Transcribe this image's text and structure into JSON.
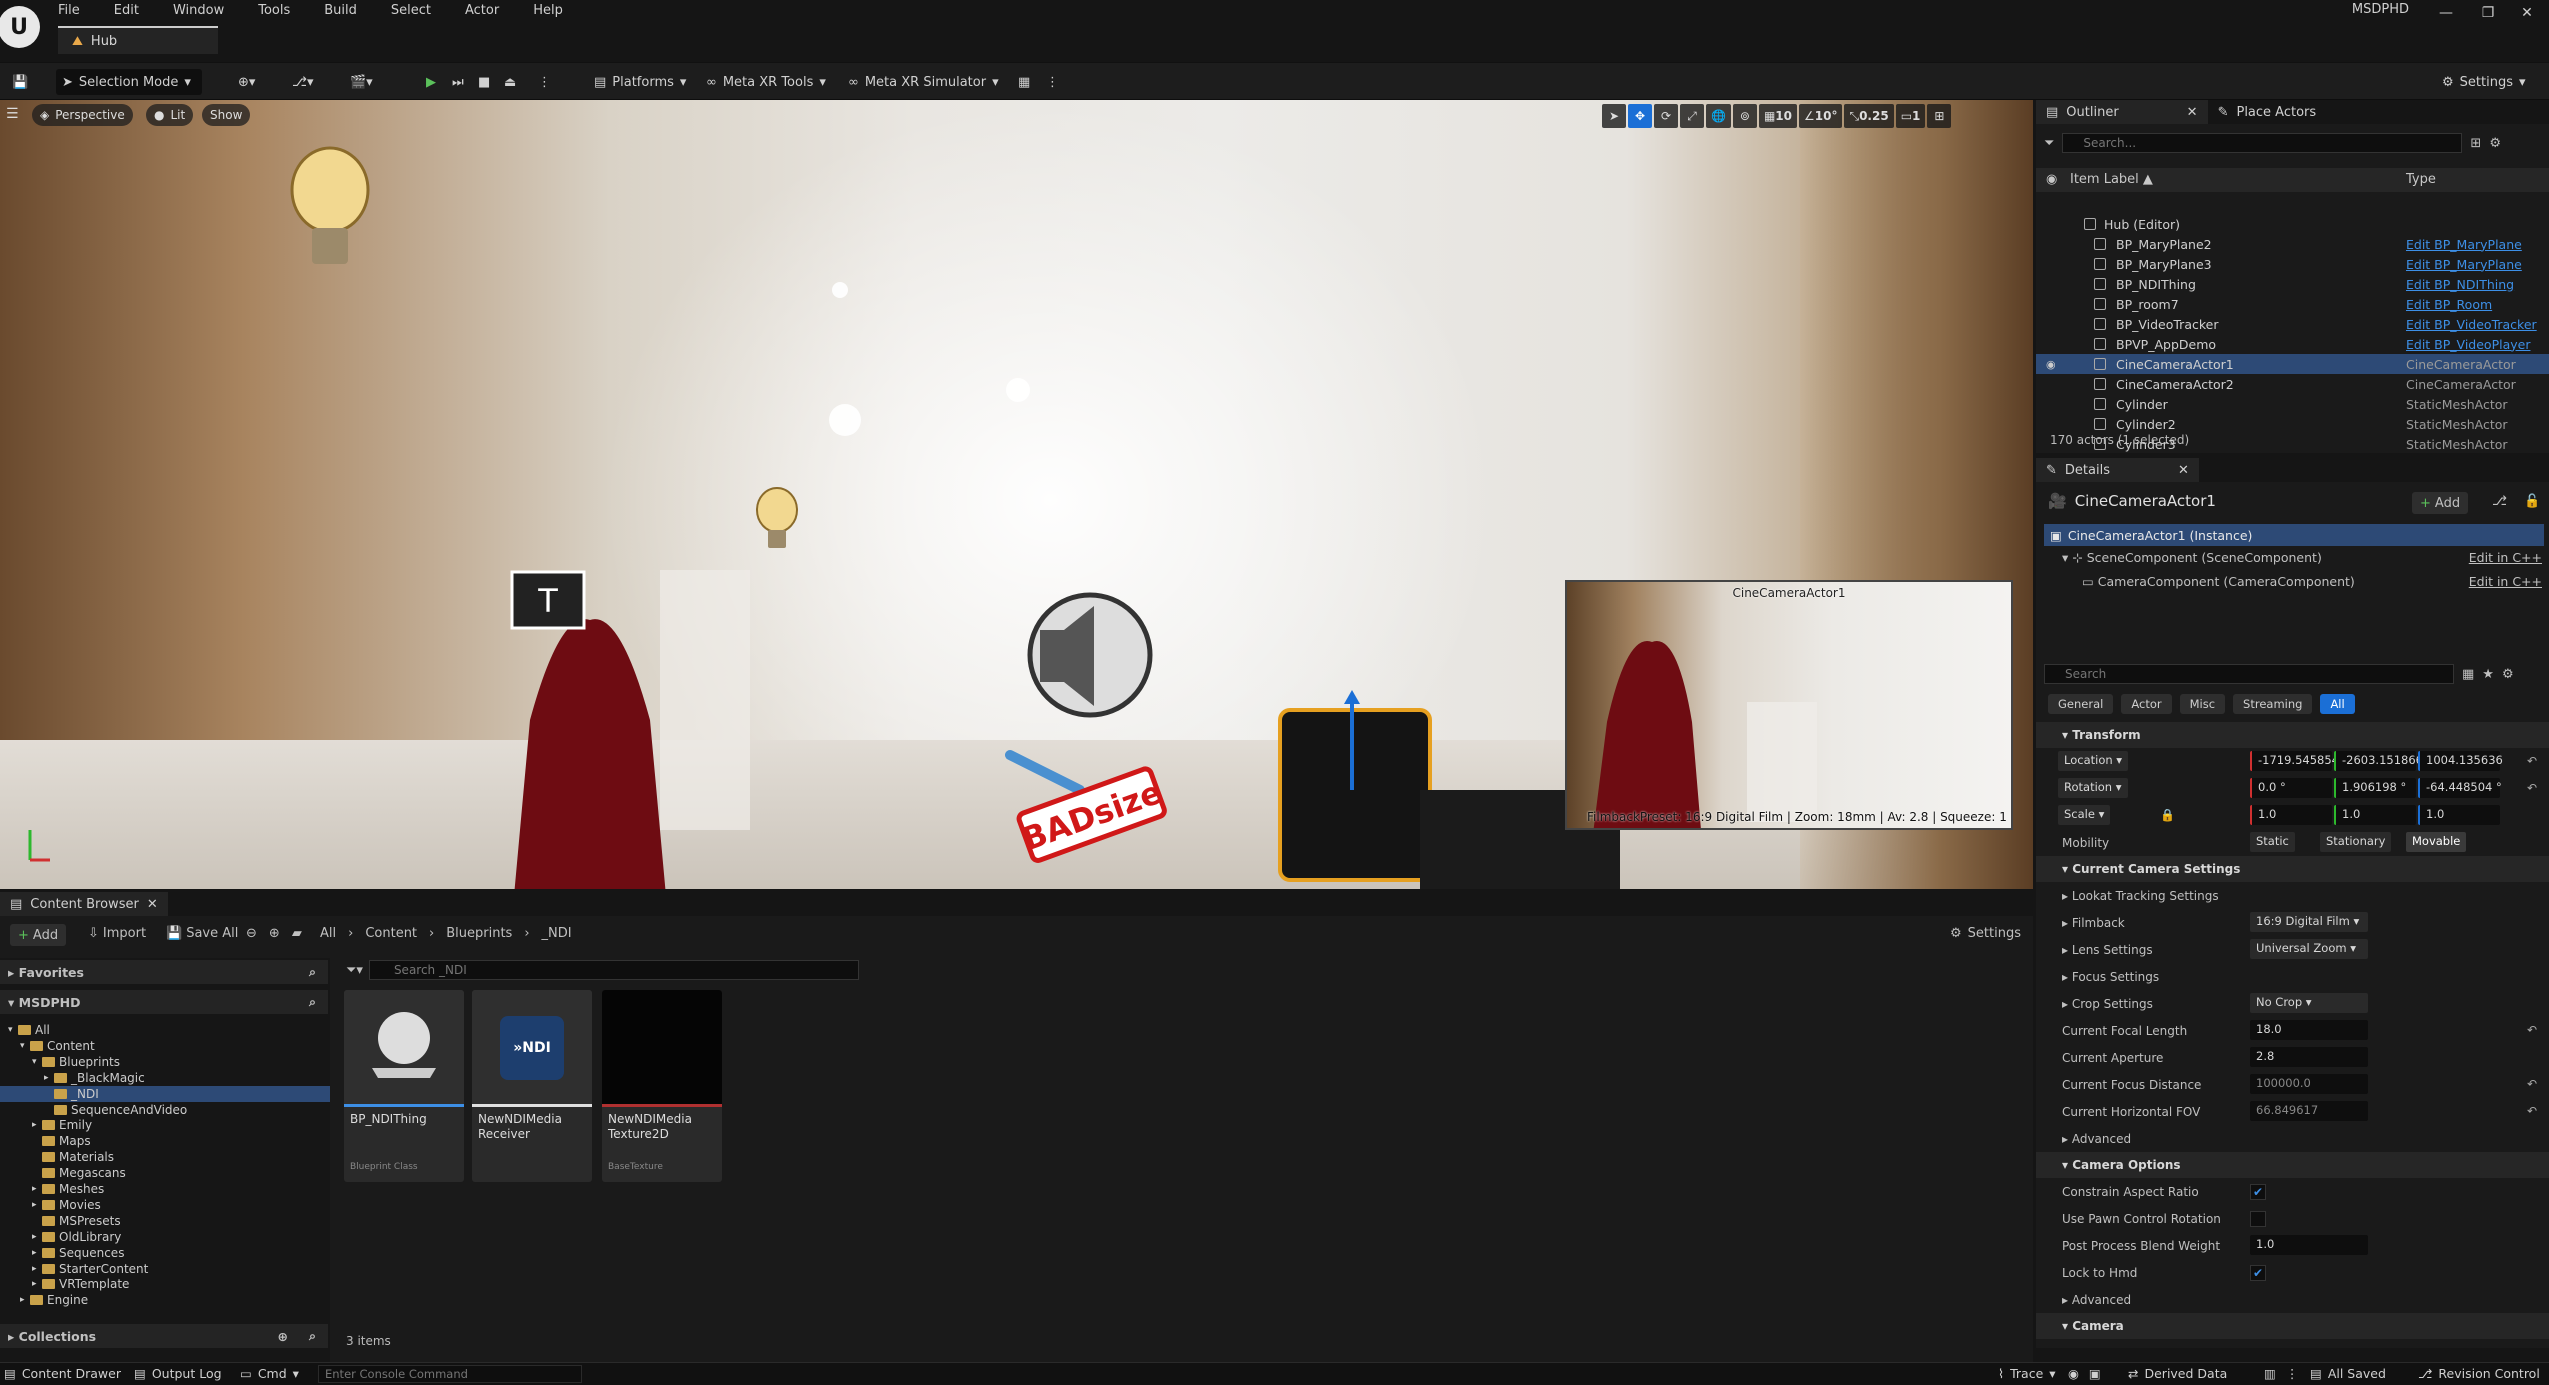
{
  "menu": {
    "items": [
      "File",
      "Edit",
      "Window",
      "Tools",
      "Build",
      "Select",
      "Actor",
      "Help"
    ],
    "project": "MSDPHD"
  },
  "doc_tab": "Hub",
  "toolbar": {
    "mode": "Selection Mode",
    "platforms": "Platforms",
    "meta_xr_tools": "Meta XR Tools",
    "meta_xr_sim": "Meta XR Simulator",
    "settings": "Settings"
  },
  "viewport": {
    "perspective": "Perspective",
    "lit": "Lit",
    "show": "Show",
    "grid": "10",
    "angle": "10°",
    "scale": "0.25",
    "cams": "1",
    "pip_title": "CineCameraActor1",
    "pip_footer": "FilmbackPreset: 16:9 Digital Film | Zoom: 18mm | Av: 2.8 | Squeeze: 1",
    "badsize": "BADsize"
  },
  "outliner": {
    "tab": "Outliner",
    "tab2": "Place Actors",
    "search_placeholder": "Search...",
    "col_label": "Item Label",
    "col_type": "Type",
    "rows": [
      {
        "label": "Hub (Editor)",
        "type": "",
        "link": false
      },
      {
        "label": "BP_MaryPlane2",
        "type": "Edit BP_MaryPlane",
        "link": true
      },
      {
        "label": "BP_MaryPlane3",
        "type": "Edit BP_MaryPlane",
        "link": true
      },
      {
        "label": "BP_NDIThing",
        "type": "Edit BP_NDIThing",
        "link": true
      },
      {
        "label": "BP_room7",
        "type": "Edit BP_Room",
        "link": true
      },
      {
        "label": "BP_VideoTracker",
        "type": "Edit BP_VideoTracker",
        "link": true
      },
      {
        "label": "BPVP_AppDemo",
        "type": "Edit BP_VideoPlayer",
        "link": true
      },
      {
        "label": "CineCameraActor1",
        "type": "CineCameraActor",
        "link": false
      },
      {
        "label": "CineCameraActor2",
        "type": "CineCameraActor",
        "link": false
      },
      {
        "label": "Cylinder",
        "type": "StaticMeshActor",
        "link": false
      },
      {
        "label": "Cylinder2",
        "type": "StaticMeshActor",
        "link": false
      },
      {
        "label": "Cylinder3",
        "type": "StaticMeshActor",
        "link": false
      }
    ],
    "count": "170 actors (1 selected)"
  },
  "details": {
    "tab": "Details",
    "actor": "CineCameraActor1",
    "add": "Add",
    "instance": "CineCameraActor1 (Instance)",
    "components": [
      {
        "name": "SceneComponent (SceneComponent)",
        "link": "Edit in C++"
      },
      {
        "name": "CameraComponent (CameraComponent)",
        "link": "Edit in C++"
      }
    ],
    "search_placeholder": "Search",
    "filters": [
      "General",
      "Actor",
      "Misc",
      "Streaming",
      "All"
    ],
    "transform": {
      "title": "Transform",
      "location_label": "Location",
      "location": [
        "-1719.545854",
        "-2603.151866",
        "1004.135636"
      ],
      "rotation_label": "Rotation",
      "rotation": [
        "0.0 °",
        "1.906198 °",
        "-64.448504 °"
      ],
      "scale_label": "Scale",
      "scale": [
        "1.0",
        "1.0",
        "1.0"
      ],
      "mobility_label": "Mobility",
      "mobility": [
        "Static",
        "Stationary",
        "Movable"
      ]
    },
    "camera_settings": {
      "title": "Current Camera Settings",
      "lookat": "Lookat Tracking Settings",
      "filmback_label": "Filmback",
      "filmback": "16:9 Digital Film",
      "lens_label": "Lens Settings",
      "lens": "Universal Zoom",
      "focus": "Focus Settings",
      "crop_label": "Crop Settings",
      "crop": "No Crop",
      "focal_label": "Current Focal Length",
      "focal": "18.0",
      "aperture_label": "Current Aperture",
      "aperture": "2.8",
      "focusdist_label": "Current Focus Distance",
      "focusdist": "100000.0",
      "fov_label": "Current Horizontal FOV",
      "fov": "66.849617",
      "advanced": "Advanced"
    },
    "camera_options": {
      "title": "Camera Options",
      "constrain": "Constrain Aspect Ratio",
      "pawn": "Use Pawn Control Rotation",
      "ppblend_label": "Post Process Blend Weight",
      "ppblend": "1.0",
      "lockhmd": "Lock to Hmd",
      "advanced": "Advanced"
    },
    "camera": "Camera"
  },
  "content_browser": {
    "tab": "Content Browser",
    "add": "Add",
    "import": "Import",
    "save_all": "Save All",
    "crumbs": [
      "All",
      "Content",
      "Blueprints",
      "_NDI"
    ],
    "settings": "Settings",
    "favorites": "Favorites",
    "project": "MSDPHD",
    "collections": "Collections",
    "search_placeholder": "Search _NDI",
    "tree": [
      "All",
      "Content",
      "Blueprints",
      "_BlackMagic",
      "_NDI",
      "SequenceAndVideo",
      "Emily",
      "Maps",
      "Materials",
      "Megascans",
      "Meshes",
      "Movies",
      "MSPresets",
      "OldLibrary",
      "Sequences",
      "StarterContent",
      "VRTemplate",
      "Engine"
    ],
    "assets": [
      {
        "name": "BP_NDIThing",
        "type": "Blueprint Class"
      },
      {
        "name": "NewNDIMedia Receiver",
        "type": ""
      },
      {
        "name": "NewNDIMedia Texture2D",
        "type": "BaseTexture"
      }
    ],
    "count": "3 items"
  },
  "status": {
    "drawer": "Content Drawer",
    "output": "Output Log",
    "cmd": "Cmd",
    "console_placeholder": "Enter Console Command",
    "trace": "Trace",
    "derived": "Derived Data",
    "saved": "All Saved",
    "revision": "Revision Control"
  }
}
